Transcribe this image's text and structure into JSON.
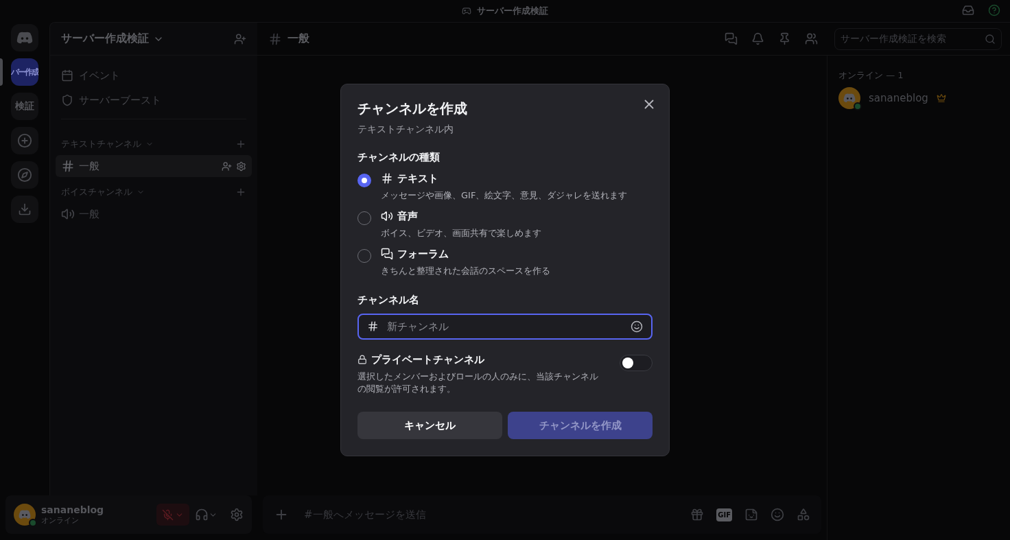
{
  "titlebar": {
    "title": "サーバー作成検証"
  },
  "servers": [
    {
      "label": "バー作成",
      "selected": true
    },
    {
      "label": "検証",
      "selected": false
    }
  ],
  "sidebar": {
    "server_name": "サーバー作成検証",
    "shortcuts": [
      {
        "kind": "event",
        "label": "イベント"
      },
      {
        "kind": "boost",
        "label": "サーバーブースト"
      }
    ],
    "categories": [
      {
        "name": "テキストチャンネル",
        "channels": [
          {
            "kind": "text",
            "name": "一般",
            "selected": true
          }
        ]
      },
      {
        "name": "ボイスチャンネル",
        "channels": [
          {
            "kind": "voice",
            "name": "一般",
            "selected": false
          }
        ]
      }
    ]
  },
  "user_panel": {
    "name": "sananeblog",
    "status": "オンライン",
    "muted": true
  },
  "header": {
    "channel": "一般",
    "search_placeholder": "サーバー作成検証を検索"
  },
  "members": {
    "heading": "オンライン — 1",
    "list": [
      {
        "name": "sananeblog",
        "owner": true
      }
    ]
  },
  "composer": {
    "placeholder": "#一般へメッセージを送信",
    "gif_label": "GIF"
  },
  "modal": {
    "title": "チャンネルを作成",
    "subtitle": "テキストチャンネル内",
    "type_heading": "チャンネルの種類",
    "types": [
      {
        "kind": "text",
        "label": "テキスト",
        "description": "メッセージや画像、GIF、絵文字、意見、ダジャレを送れます",
        "selected": true
      },
      {
        "kind": "voice",
        "label": "音声",
        "description": "ボイス、ビデオ、画面共有で楽しめます",
        "selected": false
      },
      {
        "kind": "forum",
        "label": "フォーラム",
        "description": "きちんと整理された会話のスペースを作る",
        "selected": false
      }
    ],
    "name_label": "チャンネル名",
    "name_placeholder": "新チャンネル",
    "private": {
      "label": "プライベートチャンネル",
      "description": "選択したメンバーおよびロールの人のみに、当該チャンネルの閲覧が許可されます。",
      "on": false
    },
    "cancel_label": "キャンセル",
    "create": {
      "label": "チャンネルを作成",
      "disabled": true
    }
  }
}
